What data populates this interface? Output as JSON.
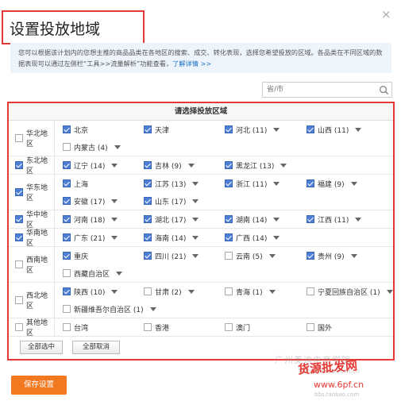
{
  "dialog": {
    "title": "设置投放地域",
    "close_glyph": "×",
    "notice_text": "您可以根据该计划内的您想主推的商品品类在各地区的搜索、成交、转化表现，选择您希望投放的区域。各品类在不同区域的数据表现可以通过左侧栏“工具>>流量解析”功能查看，",
    "notice_link": "了解详情 >>",
    "search_placeholder": "省/市",
    "search_icon": "search-icon"
  },
  "panel": {
    "header": "请选择投放区域",
    "select_all_label": "全部选中",
    "deselect_all_label": "全部取消"
  },
  "regions": [
    {
      "name": "华北地区",
      "checked": false,
      "lines": [
        [
          {
            "label": "北京",
            "checked": true,
            "dropdown": false
          },
          {
            "label": "天津",
            "checked": true,
            "dropdown": false
          },
          {
            "label": "河北 (11)",
            "checked": true,
            "dropdown": true
          },
          {
            "label": "山西 (11)",
            "checked": true,
            "dropdown": true
          }
        ],
        [
          {
            "label": "内蒙古 (4)",
            "checked": false,
            "dropdown": true
          }
        ]
      ]
    },
    {
      "name": "东北地区",
      "checked": true,
      "lines": [
        [
          {
            "label": "辽宁 (14)",
            "checked": true,
            "dropdown": true
          },
          {
            "label": "吉林 (9)",
            "checked": true,
            "dropdown": true
          },
          {
            "label": "黑龙江 (13)",
            "checked": true,
            "dropdown": true
          }
        ]
      ]
    },
    {
      "name": "华东地区",
      "checked": true,
      "lines": [
        [
          {
            "label": "上海",
            "checked": true,
            "dropdown": false
          },
          {
            "label": "江苏 (13)",
            "checked": true,
            "dropdown": true
          },
          {
            "label": "浙江 (11)",
            "checked": true,
            "dropdown": true
          },
          {
            "label": "福建 (9)",
            "checked": true,
            "dropdown": true
          }
        ],
        [
          {
            "label": "安徽 (17)",
            "checked": true,
            "dropdown": true
          },
          {
            "label": "山东 (17)",
            "checked": true,
            "dropdown": true
          }
        ]
      ]
    },
    {
      "name": "华中地区",
      "checked": true,
      "lines": [
        [
          {
            "label": "河南 (18)",
            "checked": true,
            "dropdown": true
          },
          {
            "label": "湖北 (17)",
            "checked": true,
            "dropdown": true
          },
          {
            "label": "湖南 (14)",
            "checked": true,
            "dropdown": true
          },
          {
            "label": "江西 (11)",
            "checked": true,
            "dropdown": true
          }
        ]
      ]
    },
    {
      "name": "华南地区",
      "checked": true,
      "lines": [
        [
          {
            "label": "广东 (21)",
            "checked": true,
            "dropdown": true
          },
          {
            "label": "海南 (14)",
            "checked": true,
            "dropdown": true
          },
          {
            "label": "广西 (14)",
            "checked": true,
            "dropdown": true
          }
        ]
      ]
    },
    {
      "name": "西南地区",
      "checked": false,
      "lines": [
        [
          {
            "label": "重庆",
            "checked": true,
            "dropdown": false
          },
          {
            "label": "四川 (21)",
            "checked": true,
            "dropdown": true
          },
          {
            "label": "云南 (5)",
            "checked": false,
            "dropdown": true
          },
          {
            "label": "贵州 (9)",
            "checked": true,
            "dropdown": true
          }
        ],
        [
          {
            "label": "西藏自治区",
            "checked": false,
            "dropdown": true
          }
        ]
      ]
    },
    {
      "name": "西北地区",
      "checked": false,
      "lines": [
        [
          {
            "label": "陕西 (10)",
            "checked": true,
            "dropdown": true
          },
          {
            "label": "甘肃 (2)",
            "checked": false,
            "dropdown": true
          },
          {
            "label": "青海 (1)",
            "checked": false,
            "dropdown": true
          },
          {
            "label": "宁夏回族自治区 (1)",
            "checked": false,
            "dropdown": true
          }
        ],
        [
          {
            "label": "新疆维吾尔自治区 (1)",
            "checked": false,
            "dropdown": true
          }
        ]
      ]
    },
    {
      "name": "其他地区",
      "checked": false,
      "lines": [
        [
          {
            "label": "台湾",
            "checked": false,
            "dropdown": false
          },
          {
            "label": "香港",
            "checked": false,
            "dropdown": false
          },
          {
            "label": "澳门",
            "checked": false,
            "dropdown": false
          },
          {
            "label": "国外",
            "checked": false,
            "dropdown": false
          }
        ]
      ]
    }
  ],
  "footer": {
    "save_label": "保存设置"
  },
  "watermark": {
    "line1": "广州美迪电商学院",
    "line2": "货源批发网",
    "line3": "www.6pf.cn",
    "line4": "www.Meibe.com.cn",
    "line5": "bbs.taobao.com"
  },
  "colors": {
    "highlight_border": "#e53935",
    "checkbox_on": "#4f7fd4",
    "save_button": "#f37921",
    "link": "#1a6fc4"
  }
}
